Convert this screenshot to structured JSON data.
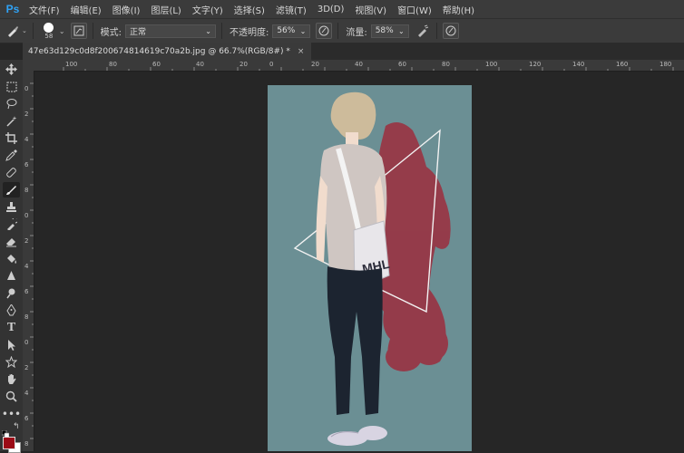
{
  "app": {
    "logo": "Ps"
  },
  "menu": [
    "文件(F)",
    "编辑(E)",
    "图像(I)",
    "图层(L)",
    "文字(Y)",
    "选择(S)",
    "滤镜(T)",
    "3D(D)",
    "视图(V)",
    "窗口(W)",
    "帮助(H)"
  ],
  "options": {
    "brush_size": "58",
    "mode_label": "模式:",
    "mode_value": "正常",
    "opacity_label": "不透明度:",
    "opacity_value": "56%",
    "flow_label": "流量:",
    "flow_value": "58%"
  },
  "document": {
    "tab_title": "47e63d129c0d8f200674814619c70a2b.jpg @ 66.7%(RGB/8#) *",
    "close": "×"
  },
  "ruler_h": [
    "100",
    "80",
    "60",
    "40",
    "20",
    "0",
    "20",
    "40",
    "60",
    "80",
    "100",
    "120",
    "140",
    "160",
    "180"
  ],
  "ruler_v": [
    "0",
    "2",
    "4",
    "6",
    "8",
    "0",
    "2",
    "4",
    "6",
    "8",
    "0",
    "2",
    "4",
    "6",
    "8"
  ],
  "illustration": {
    "bag_text": "MHL"
  },
  "colors": {
    "foreground": "#9b0a16",
    "background": "#ffffff",
    "canvas_bg": "#6b8f94",
    "brush_stroke": "#a51c2e"
  }
}
